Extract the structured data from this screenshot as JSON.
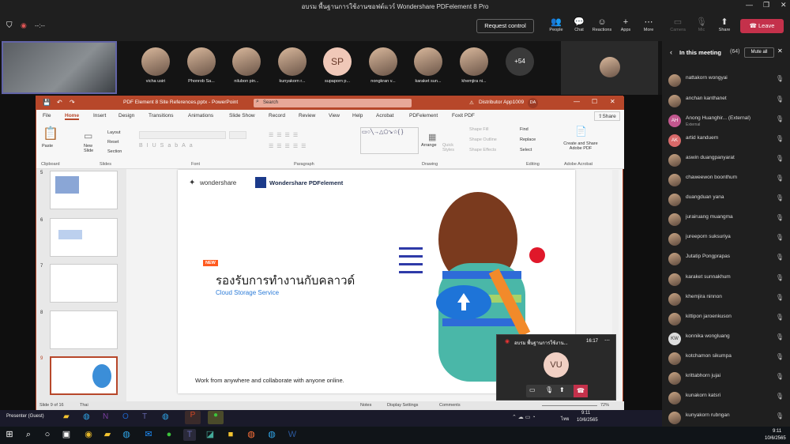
{
  "teams": {
    "window_title": "อบรม พื้นฐานการใช้งานซอฟต์แวร์ Wondershare PDFelement 8 Pro",
    "timer": "--:--",
    "request_control": "Request control",
    "toolbar": [
      {
        "label": "People",
        "icon": "people-icon"
      },
      {
        "label": "Chat",
        "icon": "chat-icon"
      },
      {
        "label": "Reactions",
        "icon": "reactions-icon"
      },
      {
        "label": "Apps",
        "icon": "apps-icon"
      },
      {
        "label": "More",
        "icon": "more-icon"
      },
      {
        "label": "Camera",
        "icon": "camera-icon"
      },
      {
        "label": "Mic",
        "icon": "mic-icon"
      },
      {
        "label": "Share",
        "icon": "share-icon"
      }
    ],
    "leave": "Leave",
    "participants": [
      "vicha usiri",
      "Phonrob Sa...",
      "nilubon pin...",
      "kunyakorn r...",
      "supaporn p...",
      "nongkran v...",
      "karaket sun...",
      "khemjira ni..."
    ],
    "sp_initials": "SP",
    "overflow_count": "+54"
  },
  "panel": {
    "title": "In this meeting",
    "count": "(64)",
    "mute_all": "Mute all",
    "people": [
      {
        "name": "nattakorn wongyai"
      },
      {
        "name": "anchan kanthanet"
      },
      {
        "name": "Anong Huanghir... (External)",
        "initials": "AH",
        "sub": "External"
      },
      {
        "name": "artid kanduem",
        "initials": "AK"
      },
      {
        "name": "aswin duangpanyarat"
      },
      {
        "name": "chaweewon boonthum"
      },
      {
        "name": "duangduan yana"
      },
      {
        "name": "jurairuang muangma"
      },
      {
        "name": "jureeporn suksuriya"
      },
      {
        "name": "Jutatip Pongprapas"
      },
      {
        "name": "karaket sunnakhum"
      },
      {
        "name": "khemjira ninnon"
      },
      {
        "name": "kittipon jaroenkuson"
      },
      {
        "name": "konnika wongluang",
        "initials": "KW"
      },
      {
        "name": "kotchamon sikumpa"
      },
      {
        "name": "krittabhorn jujai"
      },
      {
        "name": "kunakorn katsri"
      },
      {
        "name": "kunyakorn rubngan"
      }
    ]
  },
  "ppt": {
    "file": "PDF Element 8 Site References.pptx - PowerPoint",
    "search": "Search",
    "warning": "Distributor App1009",
    "user_initials": "DA",
    "tabs": [
      "File",
      "Home",
      "Insert",
      "Design",
      "Transitions",
      "Animations",
      "Slide Show",
      "Record",
      "Review",
      "View",
      "Help",
      "Acrobat",
      "PDFelement",
      "Foxit PDF"
    ],
    "share": "Share",
    "groups": [
      "Clipboard",
      "Slides",
      "Font",
      "Paragraph",
      "Drawing",
      "Editing",
      "Adobe Acrobat"
    ],
    "ribbon_labels": [
      "Paste",
      "New Slide",
      "Layout",
      "Reset",
      "Section",
      "Arrange",
      "Quick Styles",
      "Shape Fill",
      "Shape Outline",
      "Shape Effects",
      "Find",
      "Replace",
      "Select",
      "Create and Share Adobe PDF"
    ],
    "slide_numbers": [
      "5",
      "6",
      "7",
      "8",
      "9"
    ],
    "status": {
      "slide": "Slide 9 of 16",
      "lang": "Thai",
      "notes": "Notes",
      "display": "Display Settings",
      "comments": "Comments",
      "zoom": "72%"
    }
  },
  "slide": {
    "brand1": "wondershare",
    "brand2": "Wondershare PDFelement",
    "badge": "NEW",
    "heading": "รองรับการทำงานกับคลาวด์",
    "sub": "Cloud Storage Service",
    "footer": "Work from anywhere and collaborate with anyone online."
  },
  "pip": {
    "title": "อบรม พื้นฐานการใช้งาน...",
    "time": "16:17",
    "initials": "VU"
  },
  "taskbar": {
    "presenter": "Presenter (Guest)",
    "time_inner": "9:11",
    "date_inner": "10/6/2565",
    "lang_inner": "ไทย",
    "time": "9:11",
    "date": "10/6/2565"
  }
}
